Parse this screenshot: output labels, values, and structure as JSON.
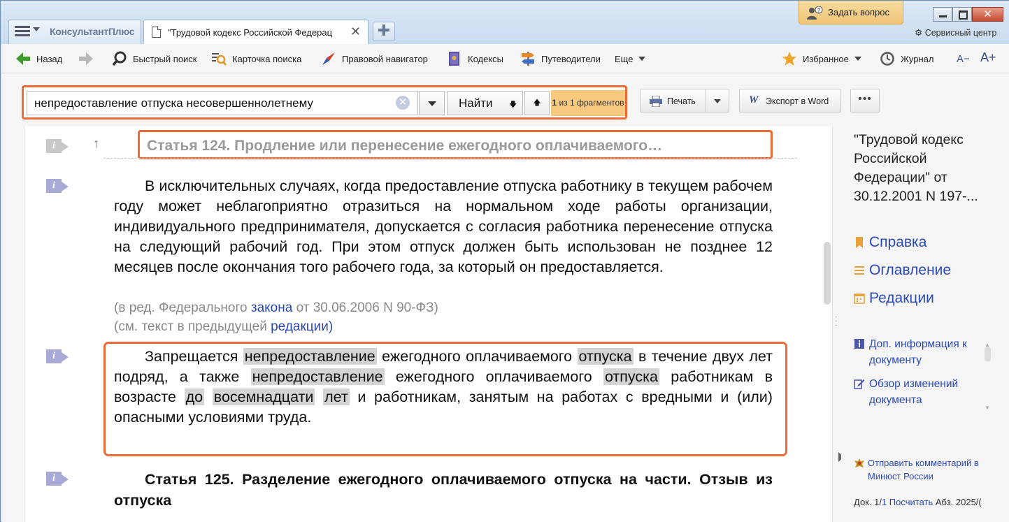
{
  "window": {
    "home_tab_label": "КонсультантПлюс",
    "doc_tab_label": "\"Трудовой кодекс Российской Федерац",
    "ask_button": "Задать вопрос",
    "service_center": "Сервисный центр"
  },
  "toolbar": {
    "back": "Назад",
    "quick_search": "Быстрый поиск",
    "search_card": "Карточка поиска",
    "legal_navigator": "Правовой навигатор",
    "codes": "Кодексы",
    "guides": "Путеводители",
    "more": "Еще",
    "favorites": "Избранное",
    "journal": "Журнал",
    "font_smaller": "A−",
    "font_larger": "A+"
  },
  "search": {
    "query": "непредоставление отпуска несовершеннолетнему",
    "find_label": "Найти",
    "fragments_count": "1",
    "fragments_text": "из 1 фрагментов",
    "print_label": "Печать",
    "export_word_label": "Экспорт в Word",
    "more_label": "•••"
  },
  "document": {
    "article_124_title": "Статья 124. Продление или перенесение ежегодного оплачиваемого…",
    "para_1": "В исключительных случаях, когда предоставление отпуска работнику в текущем рабочем году может неблагоприятно отразиться на нормальном ходе работы организации, индивидуального предпринимателя, допускается с согласия работника перенесение отпуска на следующий рабочий год. При этом отпуск должен быть использован не позднее 12 месяцев после окончания того рабочего года, за который он предоставляется.",
    "note_1_prefix": "(в ред. Федерального ",
    "note_1_link": "закона",
    "note_1_suffix": " от 30.06.2006 N 90-ФЗ)",
    "note_2_prefix": "(см. текст в предыдущей ",
    "note_2_link": "редакции)",
    "para_2": {
      "w1": "Запрещается",
      "h1": "непредоставление",
      "w2": "ежегодного оплачиваемого",
      "h2": "отпуска",
      "w3": "в течение двух лет подряд, а также",
      "h3": "непредоставление",
      "w4": "ежегодного оплачиваемого",
      "h4": "отпуска",
      "w5": "работникам в возрасте",
      "h5": "до",
      "h6": "восемнадцати",
      "h7": "лет",
      "w6": "и работникам, занятым на работах с вредными и (или) опасными условиями труда."
    },
    "article_125_title": "Статья 125. Разделение ежегодного оплачиваемого отпуска на части. Отзыв из отпуска"
  },
  "right_panel": {
    "doc_title": "\"Трудовой кодекс Российской Федерации\" от 30.12.2001 N 197-...",
    "reference": "Справка",
    "contents": "Оглавление",
    "editions": "Редакции",
    "extra_info": "Доп. информация к документу",
    "changes_review": "Обзор изменений документа",
    "send_comment": "Отправить комментарий в Минюст России",
    "status_prefix": "Док. 1/",
    "status_doc_link": "1",
    "status_count": "Посчитать",
    "status_suffix": " Абз. 2025/("
  },
  "colors": {
    "highlight_frame": "#ee6a3a",
    "link": "#2c49b8",
    "fragment_badge": "#f6c97e",
    "ask_button": "#f1c577",
    "search_hit": "#d4d4d4"
  }
}
